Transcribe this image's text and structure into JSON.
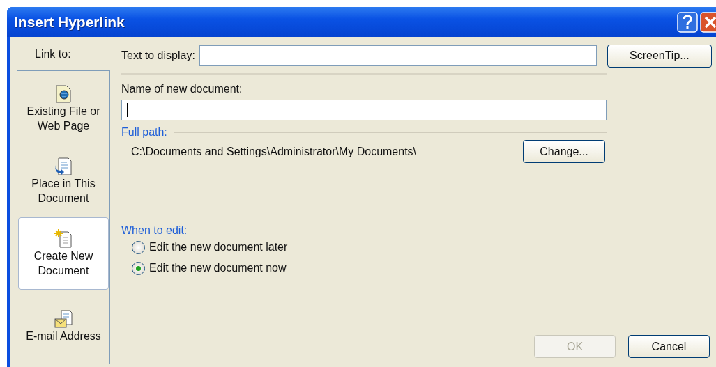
{
  "window": {
    "title": "Insert Hyperlink"
  },
  "sidebar": {
    "label": "Link to:",
    "items": [
      {
        "label": "Existing File or Web Page",
        "kind": "file",
        "selected": false
      },
      {
        "label": "Place in This Document",
        "kind": "place",
        "selected": false
      },
      {
        "label": "Create New Document",
        "kind": "new",
        "selected": true
      },
      {
        "label": "E-mail Address",
        "kind": "email",
        "selected": false
      }
    ]
  },
  "text_to_display": {
    "label": "Text to display:"
  },
  "screentip_button": "ScreenTip...",
  "new_document": {
    "label": "Name of new document:"
  },
  "full_path": {
    "label": "Full path:",
    "value": "C:\\Documents and Settings\\Administrator\\My Documents\\"
  },
  "change_button": "Change...",
  "when_to_edit": {
    "label": "When to edit:",
    "options": [
      {
        "label": "Edit the new document later",
        "selected": false
      },
      {
        "label": "Edit the new document now",
        "selected": true
      }
    ]
  },
  "buttons": [
    {
      "label": "OK",
      "disabled": true
    },
    {
      "label": "Cancel",
      "disabled": false
    }
  ]
}
